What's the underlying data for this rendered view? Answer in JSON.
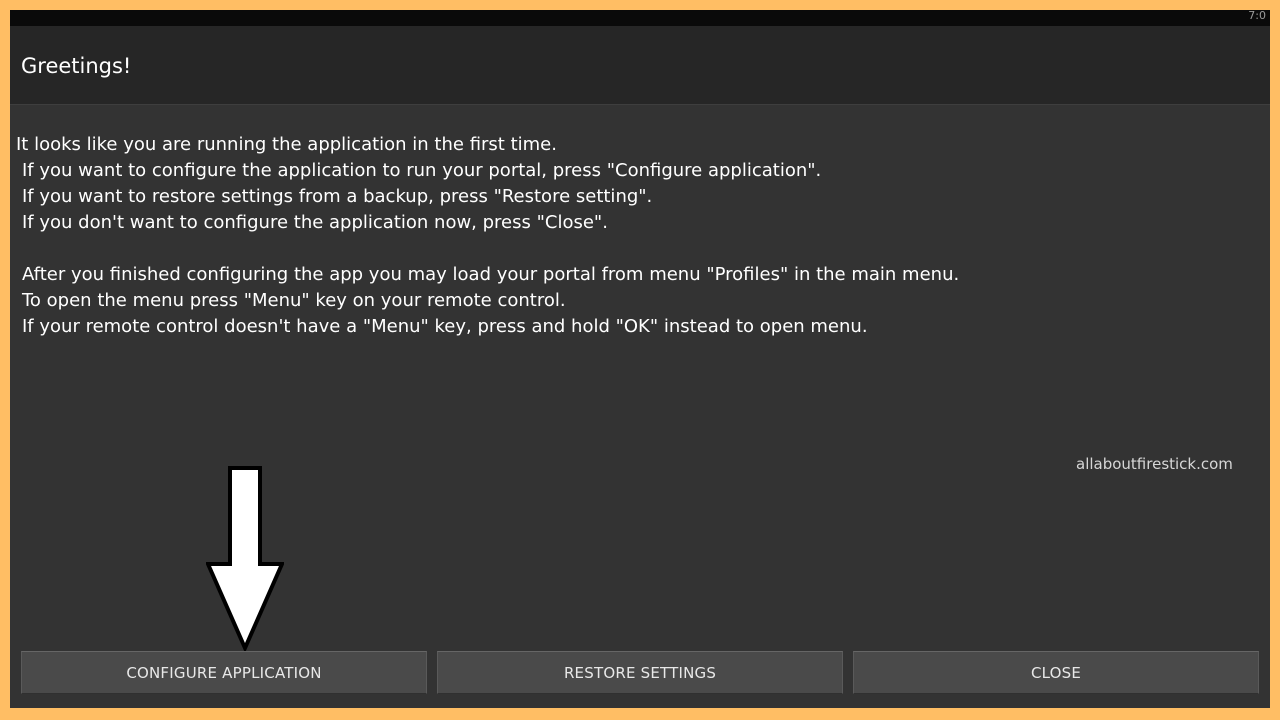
{
  "status_bar": {
    "clock_fragment": "7:0"
  },
  "dialog": {
    "title": "Greetings!",
    "message_lines": [
      "It looks like you are running the application in the first time.",
      "If you want to configure the application to run your portal, press \"Configure application\".",
      "If you want to restore settings from a backup, press \"Restore setting\".",
      "If you don't want to configure the application now, press \"Close\".",
      "After you finished configuring the app you may load your portal from menu \"Profiles\" in the main menu.",
      "To open the menu press \"Menu\" key on your remote control.",
      "If your remote control doesn't have a \"Menu\" key, press and hold \"OK\" instead to open menu."
    ],
    "buttons": {
      "configure": "CONFIGURE APPLICATION",
      "restore": "RESTORE SETTINGS",
      "close": "CLOSE"
    }
  },
  "watermark": "allaboutfirestick.com",
  "overlay": {
    "arrow_icon": "down-arrow-icon",
    "arrow_color": "#ffffff"
  },
  "colors": {
    "background_border": "#ffbe64",
    "dialog_background": "#333333",
    "title_bar": "#262626",
    "button_background": "#4a4a4a"
  }
}
